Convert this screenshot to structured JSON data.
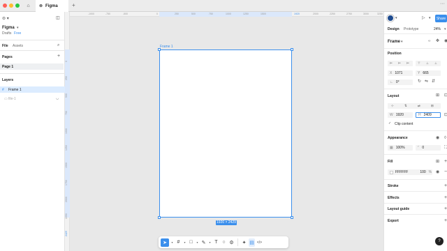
{
  "window": {
    "tab_title": "Figma"
  },
  "colors": {
    "accent": "#3b8fec",
    "close": "#ff5f57",
    "minimize": "#febc2e",
    "maximize": "#28c840",
    "selection": "#dcecff"
  },
  "left_panel": {
    "file_name": "Figma",
    "location": "Drafts",
    "plan_badge": "Free",
    "tabs": [
      "File",
      "Assets"
    ],
    "pages_header": "Pages",
    "pages": [
      "Page 1"
    ],
    "layers_header": "Layers",
    "layers": [
      {
        "name": "Frame 1",
        "selected": true
      },
      {
        "name": "file-1",
        "selected": false
      }
    ]
  },
  "rulers": {
    "top": [
      "-1000",
      "-750",
      "-500",
      "0",
      "250",
      "500",
      "750",
      "1000",
      "1250",
      "1500",
      "1920",
      "2000",
      "2250",
      "2750",
      "3000",
      "3250"
    ],
    "left": [
      "0",
      "250",
      "500",
      "750",
      "1000",
      "1250",
      "1500",
      "1750",
      "2000",
      "2250",
      "2429"
    ]
  },
  "canvas": {
    "frame_label": "Frame 1",
    "size_badge": "1920 × 2429"
  },
  "toolbar": {
    "tools": [
      {
        "name": "move-tool",
        "glyph": "➤",
        "active": true
      },
      {
        "name": "frame-tool",
        "glyph": "#"
      },
      {
        "name": "shape-tool",
        "glyph": "□"
      },
      {
        "name": "pen-tool",
        "glyph": "✎"
      },
      {
        "name": "text-tool",
        "glyph": "T"
      },
      {
        "name": "comment-tool",
        "glyph": "○"
      },
      {
        "name": "actions-tool",
        "glyph": "⚙"
      },
      {
        "name": "ai-tool",
        "glyph": "✦"
      },
      {
        "name": "dev-mode-tool",
        "glyph": "▤"
      },
      {
        "name": "code-tool",
        "glyph": "</>"
      }
    ]
  },
  "right_panel": {
    "share_label": "Share",
    "tabs": [
      "Design",
      "Prototype"
    ],
    "zoom": "24%",
    "frame_title": "Frame",
    "position_header": "Position",
    "x_label": "X",
    "x_value": "1071",
    "y_label": "Y",
    "y_value": "665",
    "rotation_value": "0°",
    "layout_header": "Layout",
    "w_label": "W",
    "w_value": "1920",
    "h_label": "H",
    "h_value": "2409",
    "clip_content": "Clip content",
    "appearance_header": "Appearance",
    "opacity": "100%",
    "radius": "0",
    "fill_header": "Fill",
    "fill_hex": "FFFFFF",
    "fill_opacity": "100",
    "fill_percent": "%",
    "sections": [
      "Stroke",
      "Effects",
      "Layout guide",
      "Export"
    ],
    "help": "?"
  }
}
